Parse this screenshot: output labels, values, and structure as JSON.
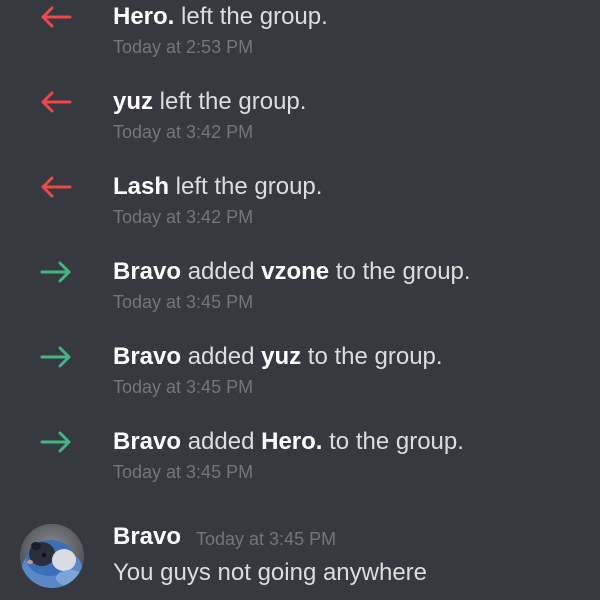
{
  "colors": {
    "background": "#36393f",
    "leave_arrow": "#f04747",
    "join_arrow": "#43b581",
    "text": "#dcddde",
    "username": "#ffffff",
    "timestamp": "#72767d"
  },
  "system_messages": [
    {
      "type": "leave",
      "icon": "left-arrow-icon",
      "actor": "Hero.",
      "text": " left the group.",
      "time": "Today at 2:53 PM"
    },
    {
      "type": "leave",
      "icon": "left-arrow-icon",
      "actor": "yuz",
      "text": " left the group.",
      "time": "Today at 3:42 PM"
    },
    {
      "type": "leave",
      "icon": "left-arrow-icon",
      "actor": "Lash",
      "text": " left the group.",
      "time": "Today at 3:42 PM"
    },
    {
      "type": "join",
      "icon": "right-arrow-icon",
      "actor": "Bravo",
      "text_before": " added ",
      "target": "vzone",
      "text_after": " to the group.",
      "time": "Today at 3:45 PM"
    },
    {
      "type": "join",
      "icon": "right-arrow-icon",
      "actor": "Bravo",
      "text_before": " added ",
      "target": "yuz",
      "text_after": " to the group.",
      "time": "Today at 3:45 PM"
    },
    {
      "type": "join",
      "icon": "right-arrow-icon",
      "actor": "Bravo",
      "text_before": " added ",
      "target": "Hero.",
      "text_after": " to the group.",
      "time": "Today at 3:45 PM"
    }
  ],
  "message": {
    "author": "Bravo",
    "time": "Today at 3:45 PM",
    "content": "You guys not going anywhere"
  }
}
